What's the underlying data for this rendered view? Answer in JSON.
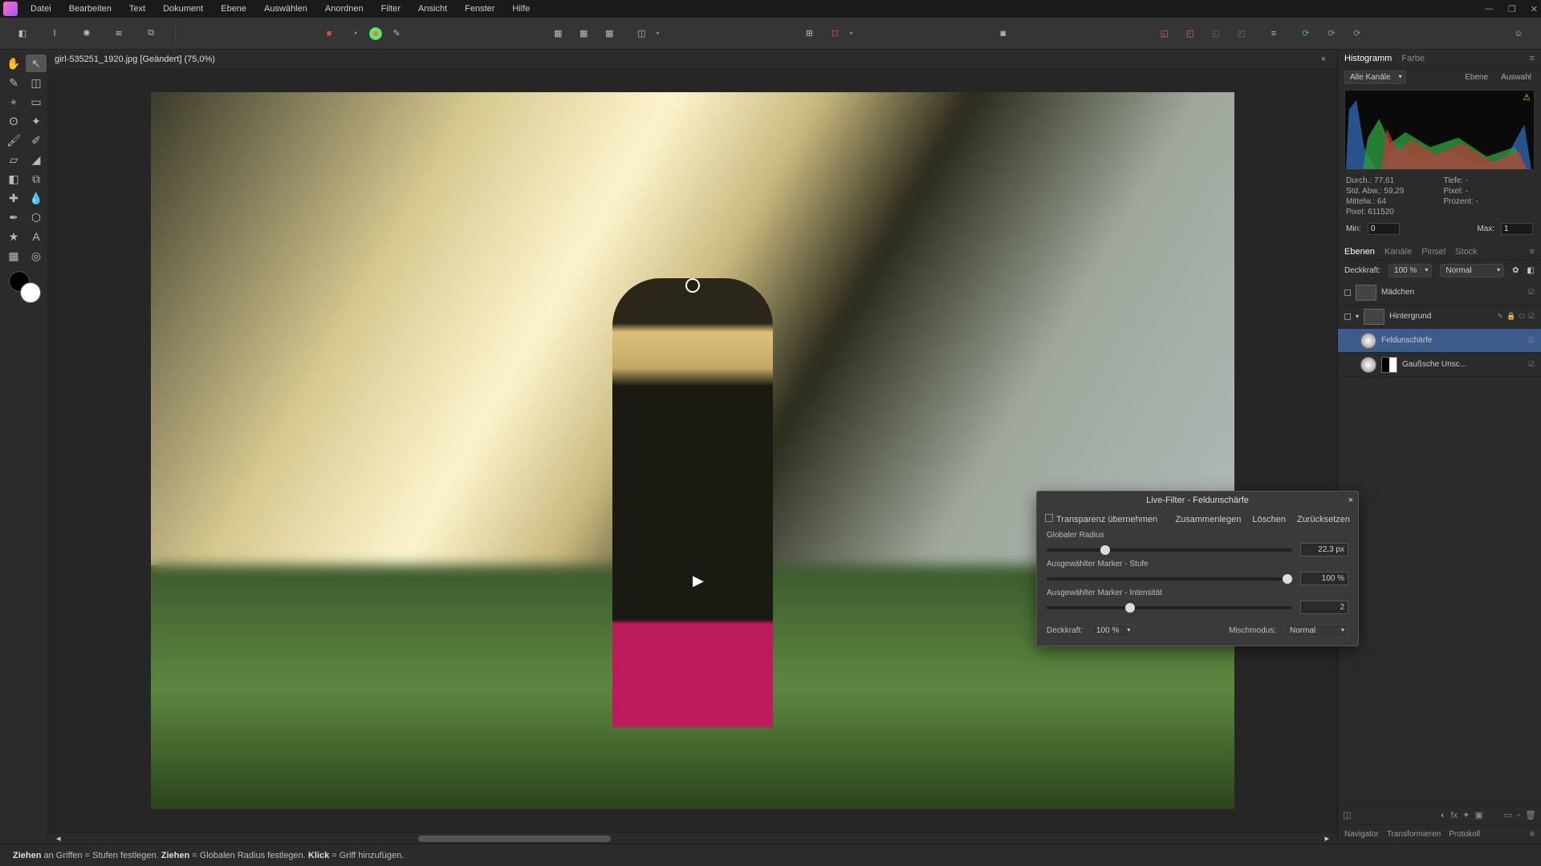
{
  "menu": {
    "items": [
      "Datei",
      "Bearbeiten",
      "Text",
      "Dokument",
      "Ebene",
      "Auswählen",
      "Anordnen",
      "Filter",
      "Ansicht",
      "Fenster",
      "Hilfe"
    ]
  },
  "doc": {
    "title": "girl-535251_1920.jpg [Geändert] (75,0%)"
  },
  "panels": {
    "histogram_tab": "Histogramm",
    "color_tab": "Farbe",
    "channels_dd": "Alle Kanäle",
    "level_btn": "Ebene",
    "sel_btn": "Auswahl"
  },
  "stats": {
    "durch": "Durch.: 77,61",
    "std": "Std. Abw.: 59,29",
    "mittel": "Mittelw.: 64",
    "pixel": "Pixel: 611520",
    "tiefe": "Tiefe: -",
    "pixel2": "Pixel: -",
    "prozent": "Prozent: -",
    "min_lbl": "Min:",
    "min_val": "0",
    "max_lbl": "Max:",
    "max_val": "1"
  },
  "layer_tabs": {
    "ebenen": "Ebenen",
    "kanale": "Kanäle",
    "pinsel": "Pinsel",
    "stock": "Stock"
  },
  "layer_hdr": {
    "deckkraft": "Deckkraft:",
    "deck_val": "100 %",
    "blend": "Normal"
  },
  "layers": [
    {
      "name": "Mädchen"
    },
    {
      "name": "Hintergrund"
    },
    {
      "name": "Feldunschärfe"
    },
    {
      "name": "Gaußsche Unsc..."
    }
  ],
  "bottom_tabs": {
    "nav": "Navigator",
    "trans": "Transformieren",
    "prot": "Protokoll"
  },
  "filter": {
    "title": "Live-Filter - Feldunschärfe",
    "transp": "Transparenz übernehmen",
    "merge": "Zusammenlegen",
    "del": "Löschen",
    "reset": "Zurücksetzen",
    "radius_lbl": "Globaler Radius",
    "radius_val": "22,3 px",
    "level_lbl": "Ausgewählter Marker - Stufe",
    "level_val": "100 %",
    "intens_lbl": "Ausgewählter Marker - Intensität",
    "intens_val": "2",
    "deck_lbl": "Deckkraft:",
    "deck_val": "100 %",
    "blend_lbl": "Mischmodus:",
    "blend_val": "Normal"
  },
  "status": {
    "t1": "Ziehen",
    "t2": " an Griffen = Stufen festlegen. ",
    "t3": "Ziehen",
    "t4": " = Globalen Radius festlegen. ",
    "t5": "Klick",
    "t6": " = Griff hinzufügen."
  }
}
